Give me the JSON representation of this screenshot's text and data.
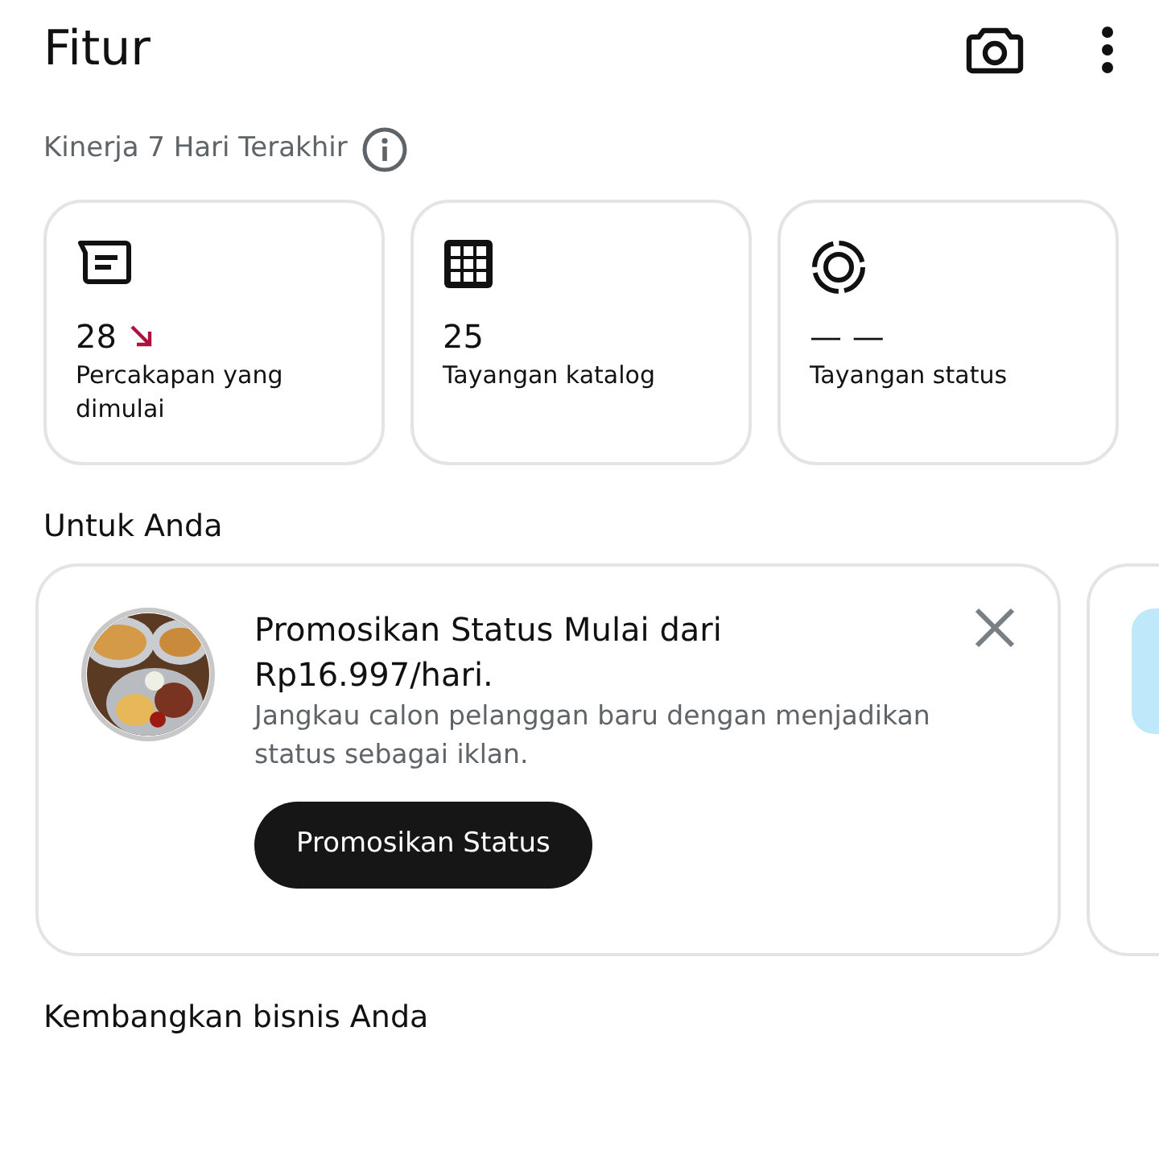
{
  "header": {
    "title": "Fitur"
  },
  "performance": {
    "label": "Kinerja 7 Hari Terakhir",
    "stats": [
      {
        "kind": "chat",
        "value": "28",
        "falling": true,
        "label": "Percakapan yang dimulai"
      },
      {
        "kind": "catalog",
        "value": "25",
        "falling": false,
        "label": "Tayangan katalog"
      },
      {
        "kind": "status",
        "value": "— —",
        "falling": false,
        "label": "Tayangan status"
      }
    ]
  },
  "for_you": {
    "label": "Untuk Anda",
    "promo": {
      "title": "Promosikan Status Mulai dari Rp16.997/hari.",
      "description": "Jangkau calon pelanggan baru dengan menjadikan status sebagai iklan.",
      "button": "Promosikan Status"
    }
  },
  "grow": {
    "label": "Kembangkan bisnis Anda"
  }
}
